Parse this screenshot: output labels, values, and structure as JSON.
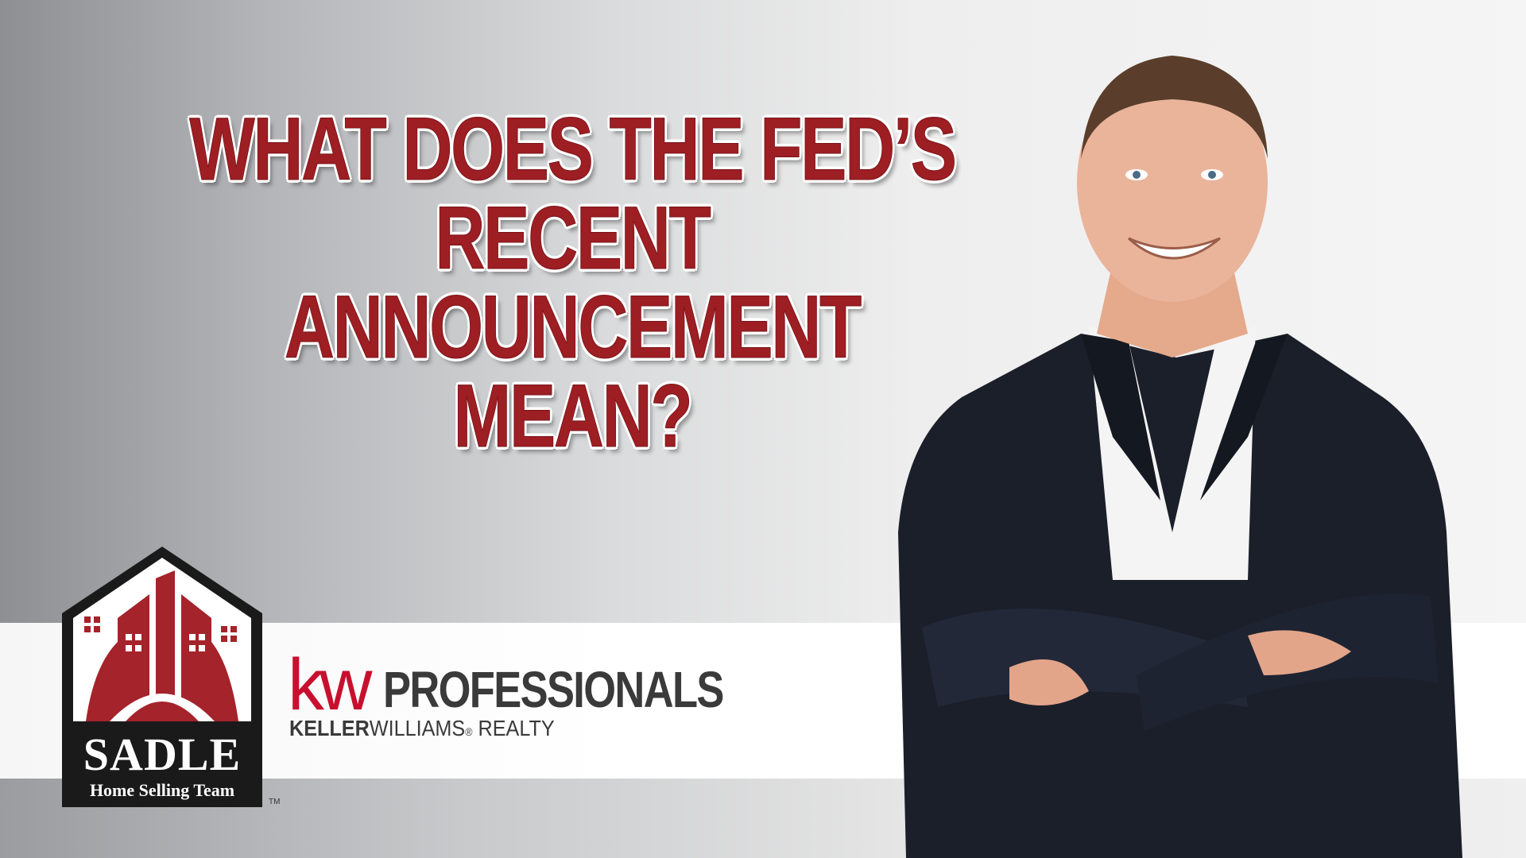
{
  "headline": {
    "line1": "WHAT DOES THE FED’S",
    "line2": "RECENT ANNOUNCEMENT",
    "line3": "MEAN?"
  },
  "sadle_logo": {
    "name": "SADLE",
    "tagline": "Home Selling Team",
    "trademark": "TM"
  },
  "kw_logo": {
    "mark": "kw",
    "professionals": "PROFESSIONALS",
    "keller": "KELLER",
    "williams": "WILLIAMS",
    "registered": "®",
    "realty": " REALTY"
  },
  "colors": {
    "headline_red": "#9d1e23",
    "kw_red": "#c8102e",
    "jacket": "#1b1f2a"
  }
}
